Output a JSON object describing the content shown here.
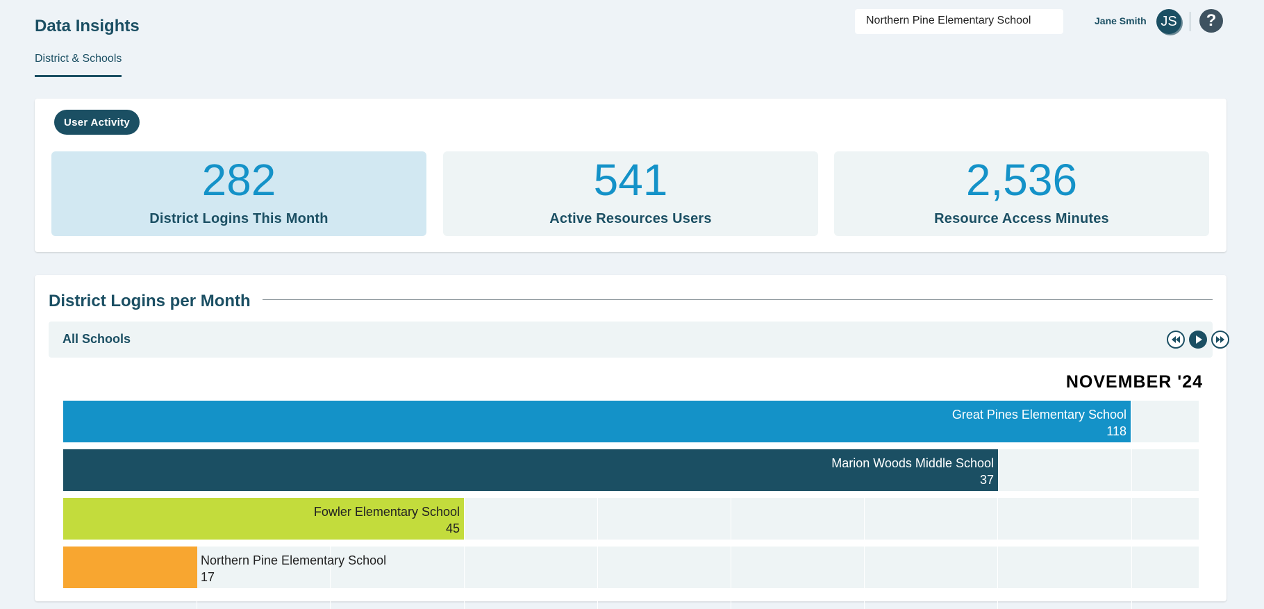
{
  "header": {
    "title": "Data Insights",
    "nav_tab": "District & Schools",
    "school_selector": "Northern Pine Elementary School",
    "user_name": "Jane Smith",
    "user_initials": "JS",
    "help_icon": "?"
  },
  "activity": {
    "pill_label": "User Activity",
    "stats": [
      {
        "value": "282",
        "label": "District Logins This Month",
        "selected": true
      },
      {
        "value": "541",
        "label": "Active Resources Users",
        "selected": false
      },
      {
        "value": "2,536",
        "label": "Resource Access Minutes",
        "selected": false
      }
    ]
  },
  "logins": {
    "section_title": "District Logins per Month",
    "filter_label": "All Schools",
    "controls": [
      "rewind-icon",
      "play-icon",
      "fast-forward-icon"
    ],
    "period": "NOVEMBER '24"
  },
  "chart_data": {
    "type": "bar",
    "orientation": "horizontal",
    "title": "NOVEMBER '24",
    "categories": [
      "Great Pines Elementary School",
      "Marion Woods Middle School",
      "Fowler Elementary School",
      "Northern Pine Elementary School"
    ],
    "values": [
      118,
      37,
      45,
      17
    ],
    "bar_extent_fraction": [
      0.94,
      0.823,
      0.353,
      0.118
    ],
    "colors": [
      "#1492c8",
      "#1b4f63",
      "#c3dc3c",
      "#f8a630"
    ],
    "label_colors": [
      "#ffffff",
      "#ffffff",
      "#222222",
      "#222222"
    ],
    "grid": true
  }
}
